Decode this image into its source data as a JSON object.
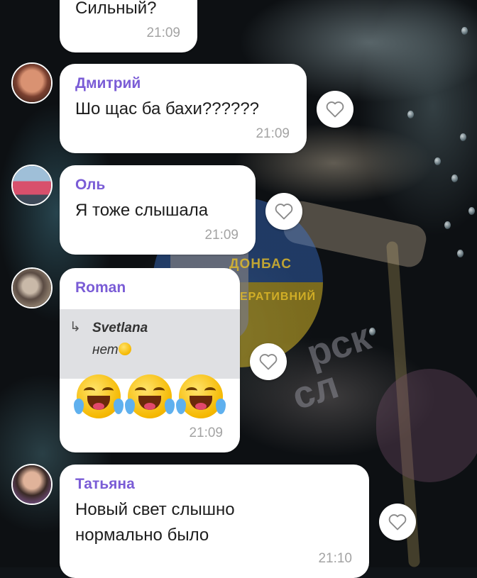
{
  "chat": {
    "messages": [
      {
        "sender": "",
        "text": "Сильный?",
        "time": "21:09"
      },
      {
        "sender": "Дмитрий",
        "text": "Шо щас ба бахи??????",
        "time": "21:09"
      },
      {
        "sender": "Оль",
        "text": "Я тоже слышала",
        "time": "21:09"
      },
      {
        "sender": "Roman",
        "reply_author": "Svetlana",
        "reply_text": "нет",
        "emojis": [
          "rofl-emoji",
          "rofl-emoji",
          "rofl-emoji"
        ],
        "time": "21:09"
      },
      {
        "sender": "Татьяна",
        "text_line1": "Новый свет слышно",
        "text_line2": "нормально было",
        "time": "21:10"
      }
    ]
  },
  "icons": {
    "like": "heart-outline-icon",
    "reply": "reply-arrow-icon",
    "reply_arrow_glyph": "↳"
  },
  "watermark": {
    "line1": "ДОНБАС",
    "line2": "ОПЕРАТИВНИЙ",
    "line3": "рск",
    "line4": "сл"
  },
  "colors": {
    "sender_name": "#7a5cd6",
    "bubble": "#ffffff",
    "time": "#a3a3a3",
    "quote_bg": "#dfe0e3"
  }
}
